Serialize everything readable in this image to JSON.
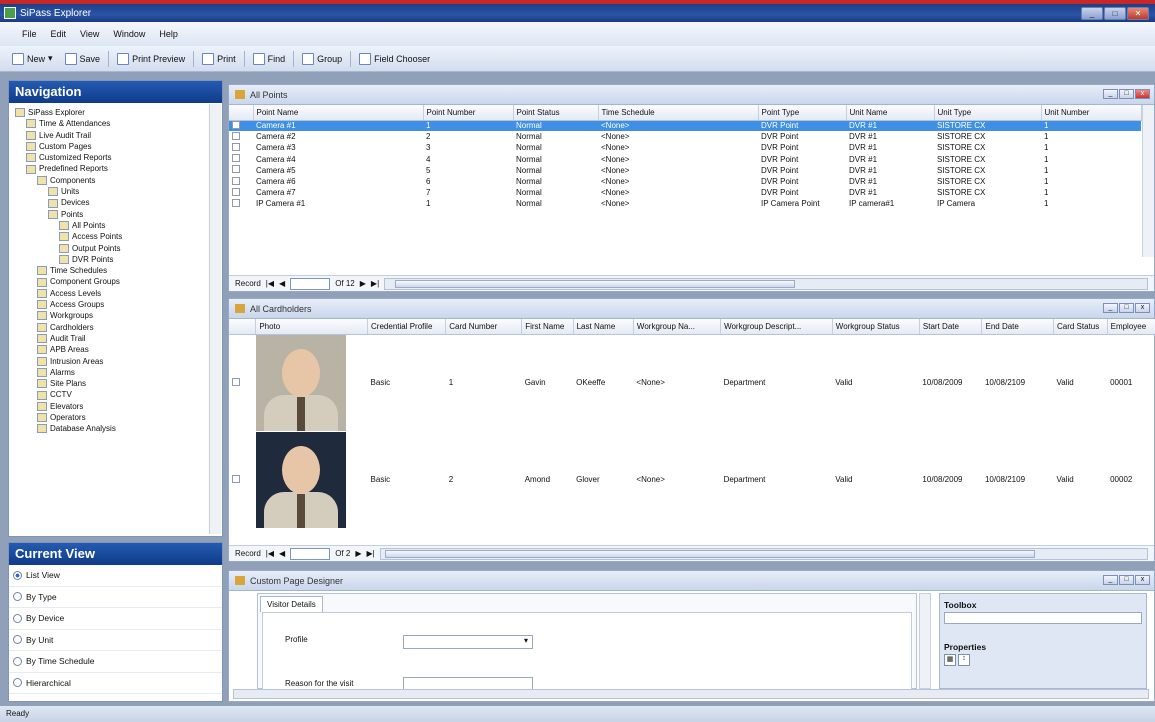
{
  "window": {
    "title": "SiPass Explorer"
  },
  "menu": [
    "File",
    "Edit",
    "View",
    "Window",
    "Help"
  ],
  "toolbar": {
    "new": "New",
    "save": "Save",
    "print_preview": "Print Preview",
    "print": "Print",
    "find": "Find",
    "group": "Group",
    "field_chooser": "Field Chooser"
  },
  "navigation": {
    "title": "Navigation",
    "tree": [
      "SiPass Explorer",
      "Time & Attendances",
      "Live Audit Trail",
      "Custom Pages",
      "Customized Reports",
      "Predefined Reports",
      "Components",
      "Units",
      "Devices",
      "Points",
      "All Points",
      "Access Points",
      "Output Points",
      "DVR Points",
      "Time Schedules",
      "Component Groups",
      "Access Levels",
      "Access Groups",
      "Workgroups",
      "Cardholders",
      "Audit Trail",
      "APB Areas",
      "Intrusion Areas",
      "Alarms",
      "Site Plans",
      "CCTV",
      "Elevators",
      "Operators",
      "Database Analysis"
    ]
  },
  "current_view": {
    "title": "Current View",
    "options": [
      "List View",
      "By Type",
      "By Device",
      "By Unit",
      "By Time Schedule",
      "Hierarchical"
    ],
    "selected": "List View"
  },
  "all_points": {
    "title": "All Points",
    "columns": [
      "Point Name",
      "Point Number",
      "Point Status",
      "Time Schedule",
      "Point Type",
      "Unit Name",
      "Unit Type",
      "Unit Number"
    ],
    "rows": [
      [
        "Camera #1",
        "1",
        "Normal",
        "<None>",
        "DVR Point",
        "DVR #1",
        "SISTORE CX",
        "1"
      ],
      [
        "Camera #2",
        "2",
        "Normal",
        "<None>",
        "DVR Point",
        "DVR #1",
        "SISTORE CX",
        "1"
      ],
      [
        "Camera #3",
        "3",
        "Normal",
        "<None>",
        "DVR Point",
        "DVR #1",
        "SISTORE CX",
        "1"
      ],
      [
        "Camera #4",
        "4",
        "Normal",
        "<None>",
        "DVR Point",
        "DVR #1",
        "SISTORE CX",
        "1"
      ],
      [
        "Camera #5",
        "5",
        "Normal",
        "<None>",
        "DVR Point",
        "DVR #1",
        "SISTORE CX",
        "1"
      ],
      [
        "Camera #6",
        "6",
        "Normal",
        "<None>",
        "DVR Point",
        "DVR #1",
        "SISTORE CX",
        "1"
      ],
      [
        "Camera #7",
        "7",
        "Normal",
        "<None>",
        "DVR Point",
        "DVR #1",
        "SISTORE CX",
        "1"
      ],
      [
        "IP Camera #1",
        "1",
        "Normal",
        "<None>",
        "IP Camera Point",
        "IP camera#1",
        "IP Camera",
        "1"
      ]
    ],
    "pager": {
      "label": "Record",
      "of": "Of 12"
    }
  },
  "cardholders": {
    "title": "All Cardholders",
    "columns": [
      "Photo",
      "Credential Profile",
      "Card Number",
      "First Name",
      "Last Name",
      "Workgroup Na...",
      "Workgroup Descript...",
      "Workgroup Status",
      "Start Date",
      "End Date",
      "Card Status",
      "Employee"
    ],
    "rows": [
      [
        "Basic",
        "1",
        "Gavin",
        "OKeeffe",
        "<None>",
        "Department",
        "Valid",
        "10/08/2009",
        "10/08/2109",
        "Valid",
        "00001"
      ],
      [
        "Basic",
        "2",
        "Amond",
        "Glover",
        "<None>",
        "Department",
        "Valid",
        "10/08/2009",
        "10/08/2109",
        "Valid",
        "00002"
      ]
    ],
    "pager": {
      "label": "Record",
      "of": "Of 2"
    }
  },
  "designer": {
    "title": "Custom Page Designer",
    "tab": "Visitor Details",
    "fields": {
      "profile_label": "Profile",
      "reason_label": "Reason for the visit"
    },
    "toolbox_title": "Toolbox",
    "properties_title": "Properties"
  },
  "status": "Ready"
}
